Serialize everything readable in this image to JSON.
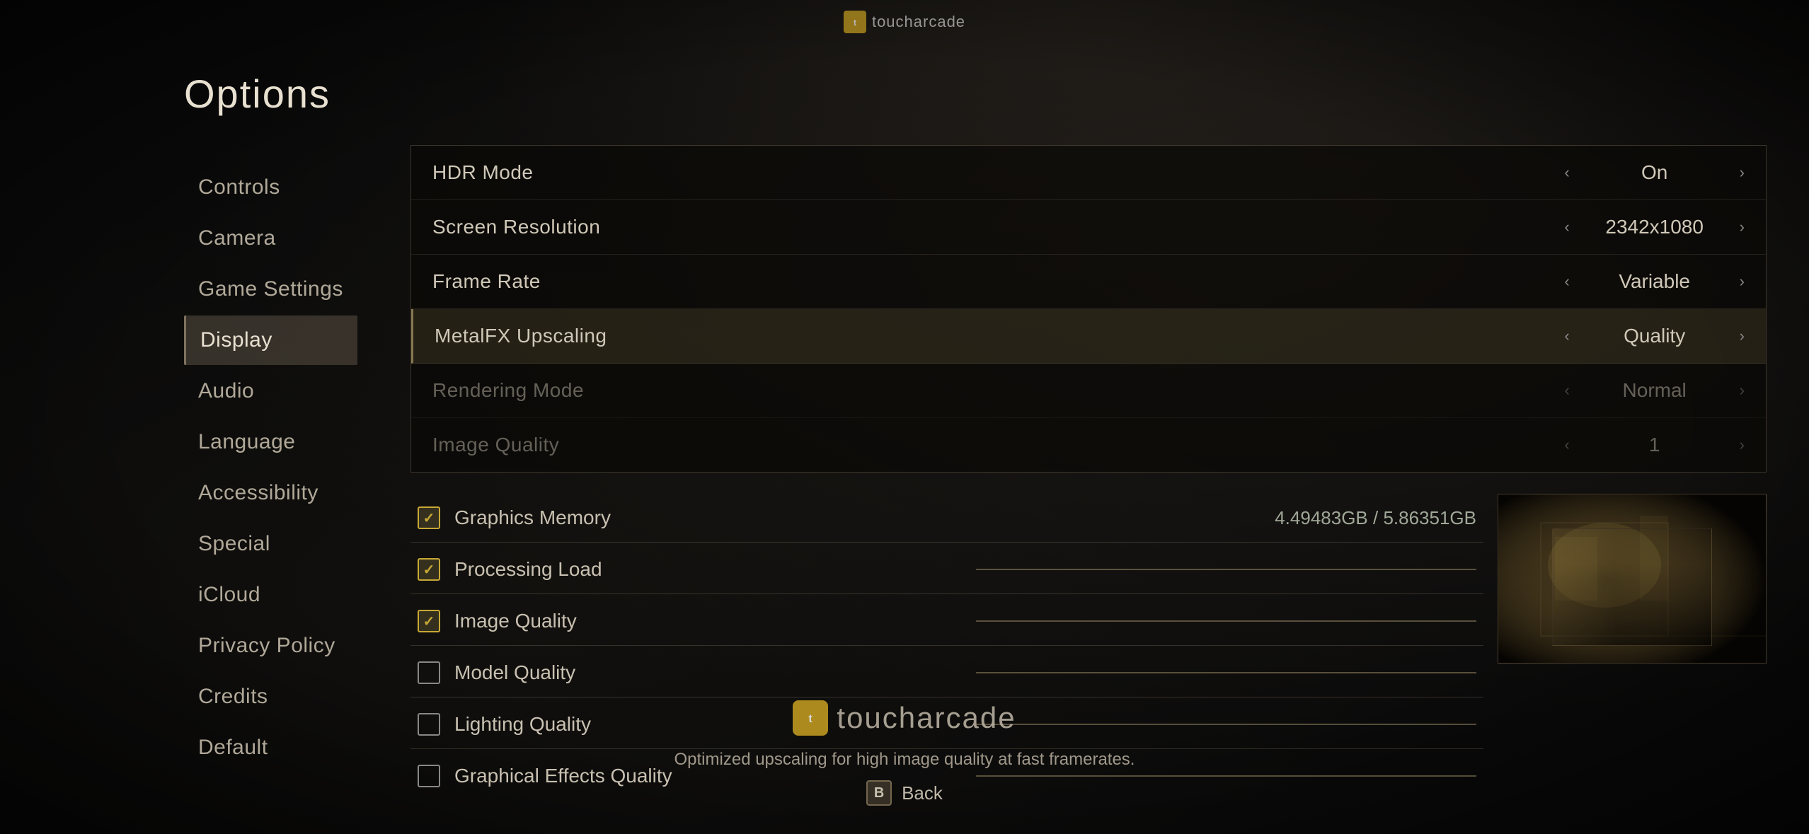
{
  "page": {
    "title": "Options",
    "watermark": {
      "label": "toucharcade",
      "icon_text": "ta"
    }
  },
  "sidebar": {
    "items": [
      {
        "id": "controls",
        "label": "Controls",
        "active": false
      },
      {
        "id": "camera",
        "label": "Camera",
        "active": false
      },
      {
        "id": "game-settings",
        "label": "Game Settings",
        "active": false
      },
      {
        "id": "display",
        "label": "Display",
        "active": true
      },
      {
        "id": "audio",
        "label": "Audio",
        "active": false
      },
      {
        "id": "language",
        "label": "Language",
        "active": false
      },
      {
        "id": "accessibility",
        "label": "Accessibility",
        "active": false
      },
      {
        "id": "special",
        "label": "Special",
        "active": false
      },
      {
        "id": "icloud",
        "label": "iCloud",
        "active": false
      },
      {
        "id": "privacy-policy",
        "label": "Privacy Policy",
        "active": false
      },
      {
        "id": "credits",
        "label": "Credits",
        "active": false
      },
      {
        "id": "default",
        "label": "Default",
        "active": false
      }
    ]
  },
  "settings": {
    "rows": [
      {
        "id": "hdr-mode",
        "label": "HDR Mode",
        "value": "On",
        "highlighted": false,
        "dimmed": false
      },
      {
        "id": "screen-resolution",
        "label": "Screen Resolution",
        "value": "2342x1080",
        "highlighted": false,
        "dimmed": false
      },
      {
        "id": "frame-rate",
        "label": "Frame Rate",
        "value": "Variable",
        "highlighted": false,
        "dimmed": false
      },
      {
        "id": "metalfx-upscaling",
        "label": "MetalFX Upscaling",
        "value": "Quality",
        "highlighted": true,
        "dimmed": false
      },
      {
        "id": "rendering-mode",
        "label": "Rendering Mode",
        "value": "Normal",
        "highlighted": false,
        "dimmed": true
      },
      {
        "id": "image-quality",
        "label": "Image Quality",
        "value": "1",
        "highlighted": false,
        "dimmed": true
      }
    ]
  },
  "checkboxes": {
    "memory_label": "Graphics Memory",
    "memory_value": "4.49483GB  /  5.86351GB",
    "items": [
      {
        "id": "processing-load",
        "label": "Processing Load",
        "checked": true
      },
      {
        "id": "image-quality",
        "label": "Image Quality",
        "checked": true
      },
      {
        "id": "model-quality",
        "label": "Model Quality",
        "checked": false
      },
      {
        "id": "lighting-quality",
        "label": "Lighting Quality",
        "checked": false
      },
      {
        "id": "graphical-effects-quality",
        "label": "Graphical Effects Quality",
        "checked": false
      }
    ]
  },
  "bottom": {
    "hint": "Optimized upscaling for high image quality at fast framerates.",
    "back_badge": "B",
    "back_label": "Back"
  }
}
